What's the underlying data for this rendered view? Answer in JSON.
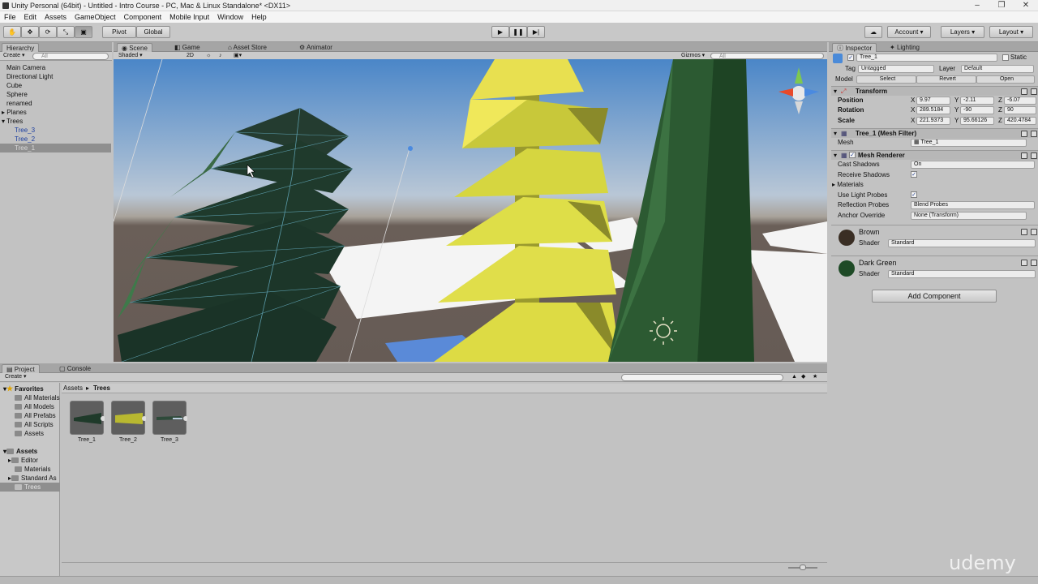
{
  "window": {
    "title": "Unity Personal (64bit) - Untitled - Intro Course - PC, Mac & Linux Standalone* <DX11>"
  },
  "menu": [
    "File",
    "Edit",
    "Assets",
    "GameObject",
    "Component",
    "Mobile Input",
    "Window",
    "Help"
  ],
  "toolbar": {
    "pivot": "Pivot",
    "global": "Global",
    "account": "Account",
    "layers": "Layers",
    "layout": "Layout"
  },
  "hierarchy": {
    "tab": "Hierarchy",
    "create": "Create",
    "search_placeholder": "All",
    "items": [
      "Main Camera",
      "Directional Light",
      "Cube",
      "Sphere",
      "renamed",
      "Planes",
      "Trees"
    ],
    "children": [
      "Tree_3",
      "Tree_2",
      "Tree_1"
    ]
  },
  "scene_tabs": [
    "Scene",
    "Game",
    "Asset Store",
    "Animator"
  ],
  "scene_bar": {
    "shading": "Shaded",
    "mode2d": "2D",
    "gizmos": "Gizmos",
    "search_placeholder": "All"
  },
  "inspector": {
    "tabs": [
      "Inspector",
      "Lighting"
    ],
    "object_name": "Tree_1",
    "static": "Static",
    "tag_label": "Tag",
    "tag_value": "Untagged",
    "layer_label": "Layer",
    "layer_value": "Default",
    "model_label": "Model",
    "model_buttons": [
      "Select",
      "Revert",
      "Open"
    ],
    "transform": {
      "title": "Transform",
      "position_label": "Position",
      "rotation_label": "Rotation",
      "scale_label": "Scale",
      "position": [
        "9.97",
        "-2.11",
        "-6.07"
      ],
      "rotation": [
        "289.5184",
        "-90",
        "90"
      ],
      "scale": [
        "221.9373",
        "95.66126",
        "420.4784"
      ],
      "axes": [
        "X",
        "Y",
        "Z"
      ]
    },
    "mesh_filter": {
      "title": "Tree_1 (Mesh Filter)",
      "mesh_label": "Mesh",
      "mesh_value": "Tree_1"
    },
    "mesh_renderer": {
      "title": "Mesh Renderer",
      "cast_shadows_label": "Cast Shadows",
      "cast_shadows_value": "On",
      "receive_shadows_label": "Receive Shadows",
      "materials_label": "Materials",
      "light_probes_label": "Use Light Probes",
      "reflection_label": "Reflection Probes",
      "reflection_value": "Blend Probes",
      "anchor_label": "Anchor Override",
      "anchor_value": "None (Transform)"
    },
    "materials": [
      {
        "name": "Brown",
        "shader_label": "Shader",
        "shader": "Standard",
        "color": "#3a2e24"
      },
      {
        "name": "Dark Green",
        "shader_label": "Shader",
        "shader": "Standard",
        "color": "#1e4a26"
      }
    ],
    "add_component": "Add Component"
  },
  "project": {
    "tabs": [
      "Project",
      "Console"
    ],
    "create": "Create",
    "favorites_title": "Favorites",
    "favorites": [
      "All Materials",
      "All Models",
      "All Prefabs",
      "All Scripts",
      "Assets"
    ],
    "assets_title": "Assets",
    "folders": [
      "Editor",
      "Materials",
      "Standard As",
      "Trees"
    ],
    "breadcrumb": [
      "Assets",
      "Trees"
    ],
    "assets": [
      {
        "name": "Tree_1",
        "color": "#1f3a2a"
      },
      {
        "name": "Tree_2",
        "color": "#b8b830"
      },
      {
        "name": "Tree_3",
        "color": "#2e4a3a"
      }
    ]
  },
  "watermark": "udemy"
}
